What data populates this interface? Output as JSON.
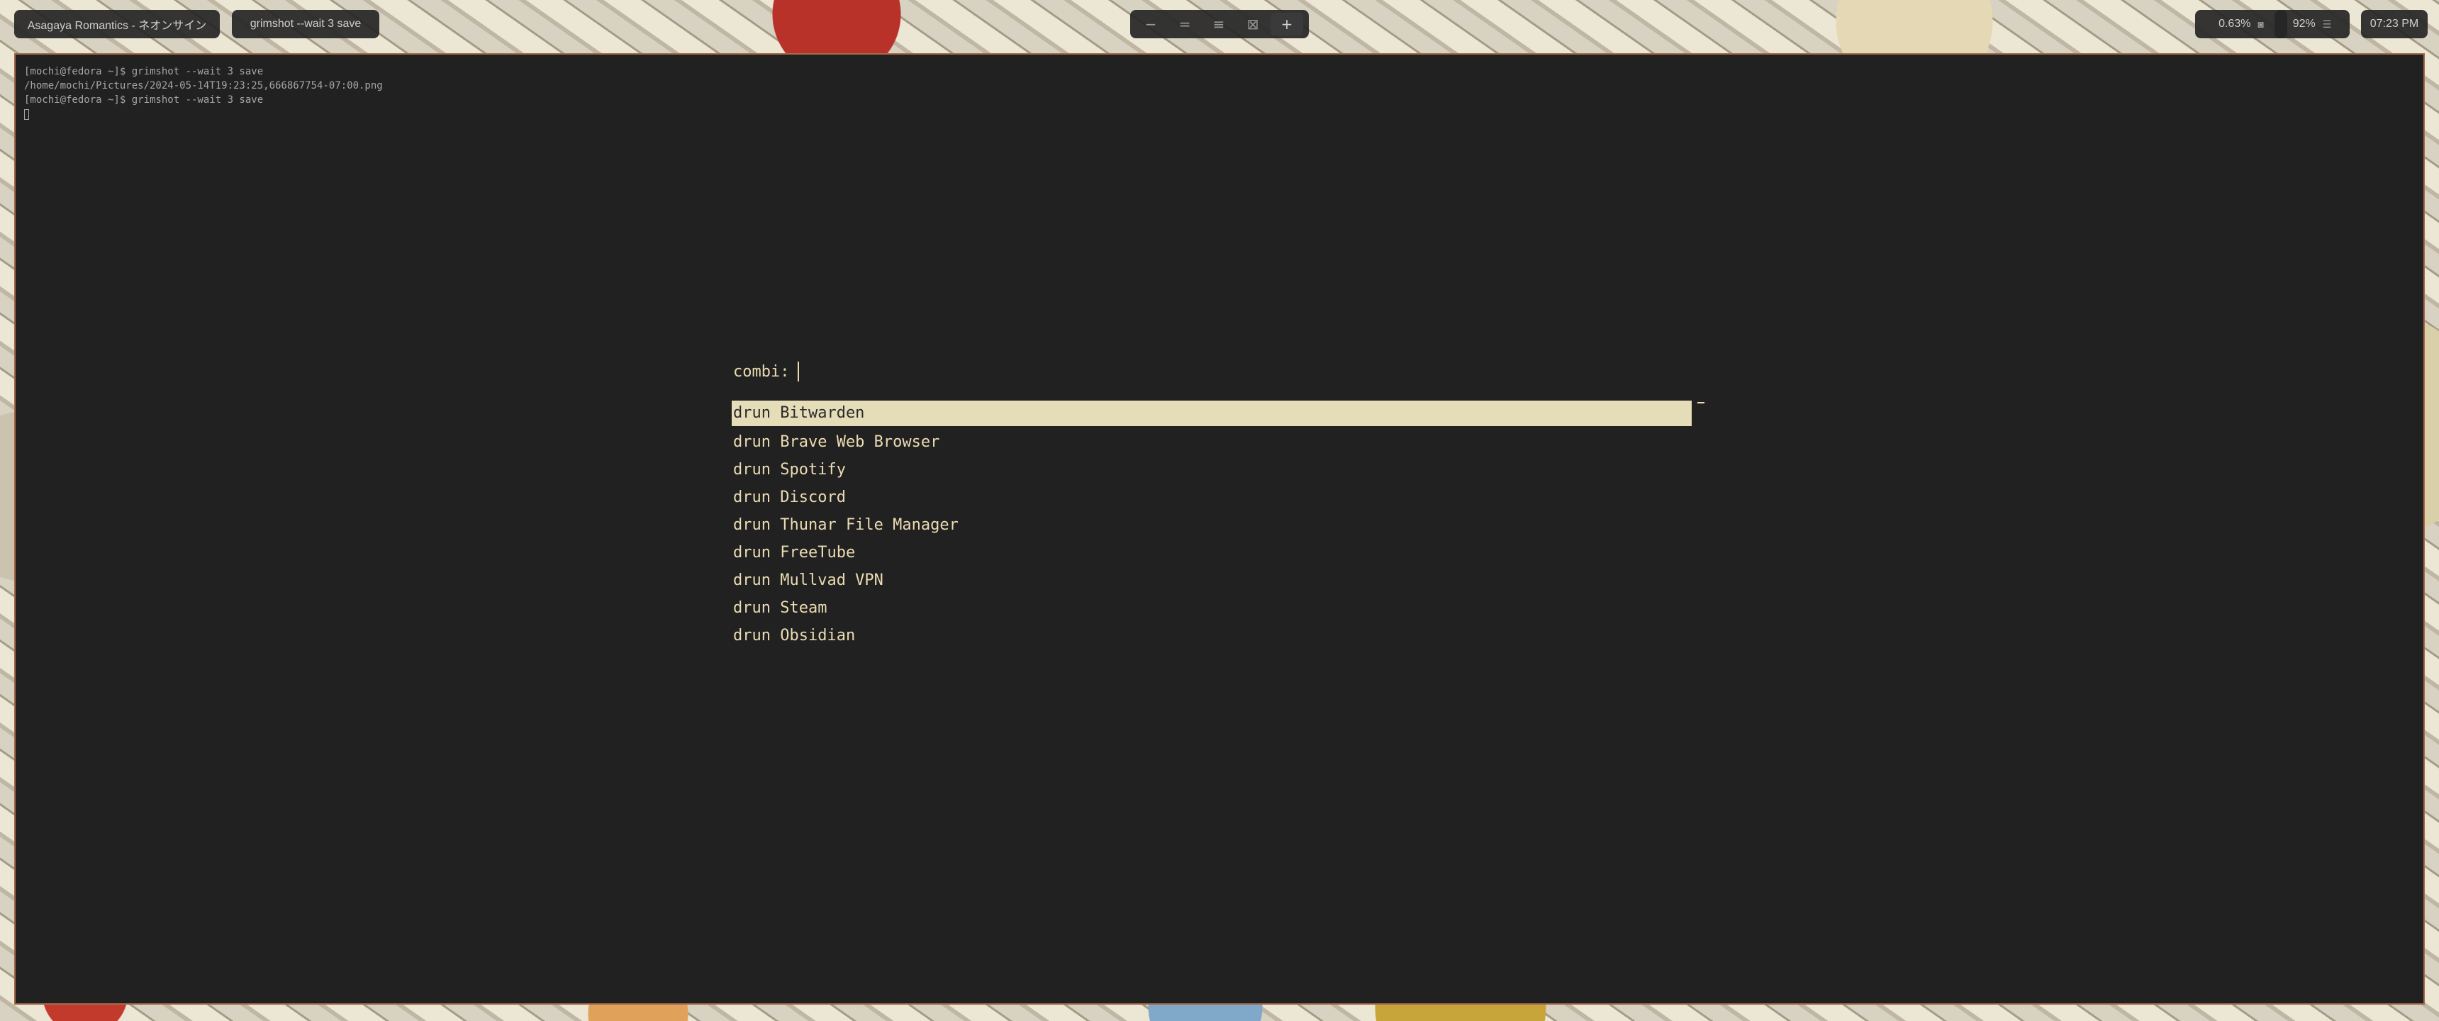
{
  "topbar": {
    "window_title": "Asagaya Romantics - ネオンサイン",
    "command": "grimshot --wait 3 save",
    "workspaces": [
      {
        "icon": "minus-icon",
        "glyph": "−"
      },
      {
        "icon": "double-line-icon",
        "glyph": "="
      },
      {
        "icon": "triple-line-icon",
        "glyph": "≡"
      },
      {
        "icon": "grid-icon",
        "glyph": "⊠"
      },
      {
        "icon": "plus-icon",
        "glyph": "+"
      }
    ],
    "active_workspace": 4,
    "cpu": "0.63%",
    "battery": "92%",
    "clock": "07:23 PM"
  },
  "terminal": {
    "lines": [
      "[mochi@fedora ~]$ grimshot --wait 3 save",
      "/home/mochi/Pictures/2024-05-14T19:23:25,666867754-07:00.png",
      "[mochi@fedora ~]$ grimshot --wait 3 save"
    ]
  },
  "launcher": {
    "prompt": "combi:",
    "query": "",
    "entries": [
      "drun Bitwarden",
      "drun Brave Web Browser",
      "drun Spotify",
      "drun Discord",
      "drun Thunar File Manager",
      "drun FreeTube",
      "drun Mullvad VPN",
      "drun Steam",
      "drun Obsidian"
    ],
    "selected_index": 0
  },
  "colors": {
    "terminal_bg": "#212121",
    "border": "#a86a4a",
    "launcher_text": "#ebdbb2",
    "selection_bg": "#e5dcb8"
  }
}
